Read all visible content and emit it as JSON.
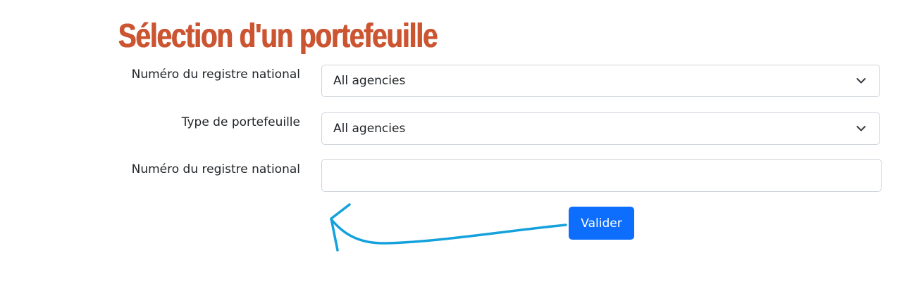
{
  "title": "Sélection d'un portefeuille",
  "form": {
    "field1": {
      "label": "Numéro du registre national",
      "selected": "All agencies"
    },
    "field2": {
      "label": "Type de portefeuille",
      "selected": "All agencies"
    },
    "field3": {
      "label": "Numéro du registre national",
      "value": ""
    },
    "submit_label": "Valider"
  },
  "icons": {
    "dropdown": "chevron-down-icon",
    "annotation": "hand-drawn-arrow-icon"
  },
  "colors": {
    "title": "#cb5431",
    "button": "#0d6efd",
    "arrow": "#14a1dc"
  }
}
